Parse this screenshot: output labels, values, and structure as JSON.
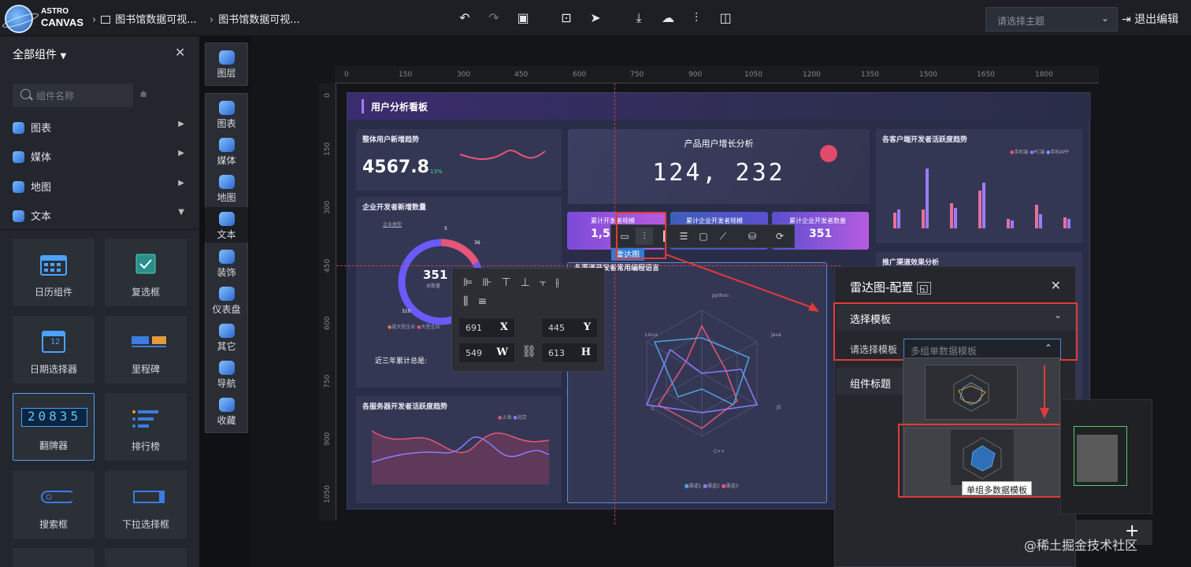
{
  "brand": {
    "line1": "ASTRO",
    "line2": "CANVAS",
    "badge": "Canvas"
  },
  "breadcrumb": [
    "图书馆数据可视...",
    "图书馆数据可视..."
  ],
  "theme": {
    "placeholder": "请选择主题"
  },
  "exit_label": "退出编辑",
  "left_panel": {
    "title": "全部组件",
    "search_placeholder": "组件名称",
    "categories": [
      "图表",
      "媒体",
      "地图",
      "文本"
    ],
    "widgets": [
      "日历组件",
      "复选框",
      "日期选择器",
      "里程碑",
      "翻牌器",
      "排行榜",
      "搜索框",
      "下拉选择框"
    ],
    "flip_digits": "20835",
    "date_digits": "12"
  },
  "rail": {
    "layers": "图层",
    "items": [
      "图表",
      "媒体",
      "地图",
      "文本",
      "装饰",
      "仪表盘",
      "其它",
      "导航",
      "收藏"
    ]
  },
  "ruler": {
    "top": [
      "0",
      "150",
      "300",
      "450",
      "600",
      "750",
      "900",
      "1050",
      "1200",
      "1350",
      "1500",
      "1650",
      "1800"
    ],
    "left": [
      "0",
      "150",
      "300",
      "450",
      "600",
      "750",
      "900",
      "1050"
    ]
  },
  "dashboard": {
    "title": "用户分析看板",
    "p1": {
      "title": "整体用户新增趋势",
      "value": "4567.8",
      "delta": "13%"
    },
    "p2": {
      "title": "产品用户增长分析",
      "counter": "124, 232"
    },
    "p3": {
      "title": "各客户端开发者活跃度趋势",
      "legend": [
        "手机端",
        "PC端",
        "手机APP"
      ]
    },
    "p4": {
      "title": "企业开发者新增数量",
      "sub": "企业类型",
      "center_value": "351",
      "center_label": "总数量",
      "n1": "36",
      "n2": "5",
      "n3": "310",
      "legend": [
        "成大型企业",
        "大型企业"
      ],
      "footer": "近三年累计总是:"
    },
    "stats": [
      {
        "label": "累计开发者规模",
        "value": "1,5"
      },
      {
        "label": "累计企业开发者规模",
        "value": ""
      },
      {
        "label": "累计企业开发者数量",
        "value": "351"
      }
    ],
    "p5": {
      "title": "各服务器开发者活跃度趋势",
      "legend": [
        "上海",
        "北京"
      ]
    },
    "radar": {
      "title": "各渠道开发者常用编程语言",
      "axes": [
        "python",
        "Java",
        "JS",
        "C++",
        "C",
        "Linux"
      ],
      "legend": [
        "渠道1",
        "渠道2",
        "渠道3"
      ]
    },
    "p6": {
      "title": "推广渠道效果分析"
    },
    "selected_tag": "雷达图"
  },
  "align_panel": {
    "x": "691",
    "y": "445",
    "w": "549",
    "h": "613",
    "x_label": "X",
    "y_label": "Y",
    "w_label": "W",
    "h_label": "H"
  },
  "config": {
    "title": "雷达图-配置",
    "section_template": "选择模板",
    "select_label": "请选择模板",
    "select_placeholder": "多组单数据模板",
    "section_title": "组件标题",
    "tooltip": "单组多数据模板"
  },
  "watermark": "@稀土掘金技术社区"
}
